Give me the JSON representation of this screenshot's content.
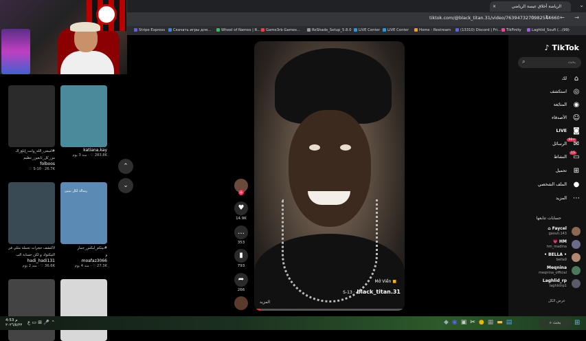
{
  "browser": {
    "tab_title": "الرياضة أخلاق عيسة الرياضي",
    "url": "tiktok.com/@black_titan.31/video/7639473270982544660",
    "bookmarks": [
      {
        "label": "Stripe Express",
        "color": "#635bff"
      },
      {
        "label": "Скачать игры для...",
        "color": "#3b82f6"
      },
      {
        "label": "Wheel of Names | R...",
        "color": "#22c55e"
      },
      {
        "label": "Game3rb Games...",
        "color": "#ef4444"
      },
      {
        "label": "ReShade_Setup_5.8.0",
        "color": "#999999"
      },
      {
        "label": "LIVE Center",
        "color": "#1d9bf0"
      },
      {
        "label": "LIVE Center",
        "color": "#1d9bf0"
      },
      {
        "label": "Home - Restream",
        "color": "#f59e0b"
      },
      {
        "label": "(13310) Discord | Fri...",
        "color": "#5865f2"
      },
      {
        "label": "TikFinity",
        "color": "#ec4899"
      },
      {
        "label": "Laghlid_Soufi (...(99)",
        "color": "#a855f7"
      }
    ]
  },
  "feed": {
    "cards": [
      {
        "caption": "#اسعى_الله_وانت_إبلغ_الـ",
        "caption2": "من_كل_تابعين_عظيم",
        "user": "folboos",
        "meta": "S-10 · 26.7K ♡",
        "thumb": "#2b2b2b"
      },
      {
        "caption": "",
        "caption2": "",
        "user": "katiana.kay",
        "meta": "283.8K ♡ · منذ 3 يوم",
        "thumb": "#4a8a9a"
      },
      {
        "caption": "لاكتشف حجرات تحملة مثلي في",
        "caption2": "التيكتوك و لكن حسابة ألب",
        "user": "hadi_hadi131",
        "meta": "36.6K ♡ · منذ 2 يوم",
        "thumb": "#3a4a55"
      },
      {
        "caption": "#بيتكم_لبكس_جمار",
        "caption2": "و",
        "user": "moafaz3066",
        "meta": "27.3K ♡ · منذ 4 يوم",
        "thumb": "#5b8bb5",
        "overlay": "رسالة لكل بيبين"
      },
      {
        "caption": "",
        "caption2": "",
        "user": "",
        "meta": "",
        "thumb": "#444"
      },
      {
        "caption": "",
        "caption2": "",
        "user": "",
        "meta": "",
        "thumb": "#d8d8d8"
      }
    ]
  },
  "video": {
    "sticker": "Mở Viền",
    "handle": "black_titan.31",
    "handle_prefix": "S-13 ·",
    "more": "المزيد",
    "progress": 0.04
  },
  "actions": {
    "likes": "14.9K",
    "comments": "353",
    "saves": "793",
    "shares": "266"
  },
  "sidebar": {
    "logo": "TikTok",
    "search_placeholder": "بحث",
    "nav": [
      {
        "label": "لك",
        "icon": "home-icon",
        "glyph": "⌂"
      },
      {
        "label": "استكشف",
        "icon": "compass-icon",
        "glyph": "◎"
      },
      {
        "label": "المتابَعة",
        "icon": "following-icon",
        "glyph": "◉"
      },
      {
        "label": "الأصدقاء",
        "icon": "friends-icon",
        "glyph": "☺"
      },
      {
        "label": "LIVE",
        "icon": "live-icon",
        "glyph": "◙"
      },
      {
        "label": "الرسائل",
        "icon": "messages-icon",
        "glyph": "✉",
        "badge": "+99"
      },
      {
        "label": "النشاط",
        "icon": "activity-icon",
        "glyph": "▭",
        "badge": "15"
      },
      {
        "label": "تحميل",
        "icon": "upload-icon",
        "glyph": "⊞"
      },
      {
        "label": "الملف الشخصي",
        "icon": "profile-icon",
        "glyph": "●"
      },
      {
        "label": "المزيد",
        "icon": "more-icon",
        "glyph": "⋯"
      }
    ],
    "following_title": "حسابات تتابعها",
    "accounts": [
      {
        "name": "Faycel ⌂",
        "handle": "gaouli.143",
        "color": "#8a6a50"
      },
      {
        "name": "HM 💗",
        "handle": "hm_madina",
        "color": "#6a6a8a"
      },
      {
        "name": "• BELLA •",
        "handle": "bella9",
        "color": "#b08a70"
      },
      {
        "name": "Meqnina",
        "handle": "meqnina_official",
        "color": "#4a7a5a"
      },
      {
        "name": "Laghlid_rp",
        "handle": "laghlidrp1",
        "color": "#5a5a6a"
      }
    ],
    "see_all": "عرض الكل"
  },
  "taskbar": {
    "time": "م 4:53",
    "date": "٢٠٢٦/٥/٢٢",
    "search": "بحث",
    "lang": "ع"
  }
}
